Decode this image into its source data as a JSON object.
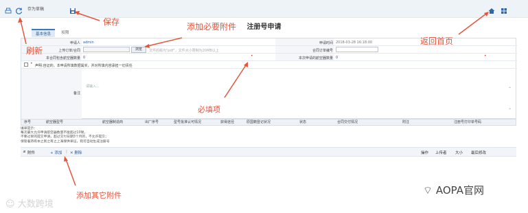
{
  "toolbar": {
    "save_draft_label": "存为草稿",
    "icons": [
      "print-icon",
      "refresh-icon",
      "save-icon",
      "home-icon",
      "grid-icon"
    ]
  },
  "page": {
    "title": "注册号申请"
  },
  "tabs": [
    {
      "label": "基本信息",
      "active": true
    },
    {
      "label": "权限",
      "active": false
    }
  ],
  "form": {
    "applicant_label": "申请人",
    "applicant_value": "admin",
    "apply_time_label": "申请时间",
    "apply_time_value": "2018-03-28 16:18:00",
    "upload_label": "上传订单/合同",
    "browse_label": "浏览",
    "upload_hint": "文件后缀为\"pdf\"，文件大小限制为20MB以上",
    "order_no_label": "合同订单编号",
    "contract_count_label": "本合同包含航空器数量",
    "contract_count_value": "0",
    "apply_count_label": "本次申请的航空器数量",
    "apply_count_value": "0",
    "declaration_text": "声明:自证的，本申请所填数据属实，并对所填内容承担一切责任",
    "remark_placeholder": "请输入...",
    "remark_label": "备注"
  },
  "grid": {
    "columns": [
      "序号",
      "航空器型号",
      "航空器制造商",
      "出厂序号",
      "型号批准认可情况",
      "获得途径",
      "原国籍登记状况",
      "状态",
      "合同交付情况",
      "附注",
      "注册号打印单号码"
    ]
  },
  "notes": [
    "填单提示：",
    "每次最大允许申请航空器数量不能超过10架。",
    "不要过早的提交申请，超过交付日期3个月的，不允许提交；",
    "保管着持有本之民之有之上海保供单证，则可自动生成注册号"
  ],
  "attachments": {
    "attach_label": "附件",
    "add_label": "添加",
    "delete_label": "删除",
    "cols": [
      "操作",
      "上传者",
      "大小",
      "最后修改"
    ]
  },
  "annotations": {
    "save": "保存",
    "add_required_attachment": "添加必要附件",
    "return_home": "返回首页",
    "refresh": "刷新",
    "required_field": "必填项",
    "add_other_attachment": "添加其它附件"
  },
  "watermarks": {
    "left": "大数跨境",
    "right": "AOPA官网"
  },
  "colors": {
    "annotation": "#e4553c",
    "required": "#e03a3a",
    "accent": "#2a5f9e"
  }
}
